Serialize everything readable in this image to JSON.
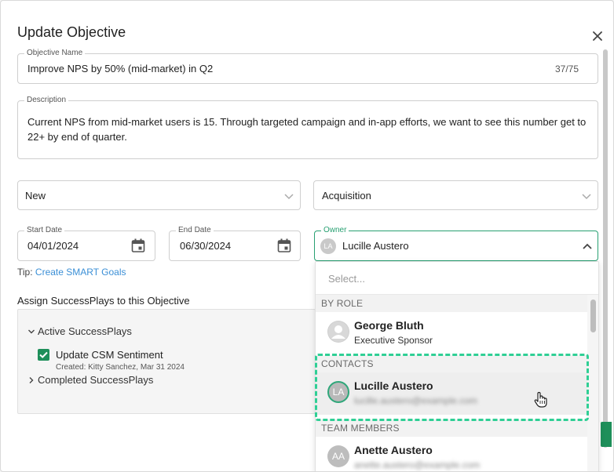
{
  "dialog": {
    "title": "Update Objective"
  },
  "objective_name": {
    "label": "Objective Name",
    "value": "Improve NPS by 50% (mid-market) in Q2",
    "counter": "37/75"
  },
  "description": {
    "label": "Description",
    "value": "Current NPS from mid-market users is 15. Through targeted campaign and in-app efforts, we want to see this number get to 22+ by end of quarter."
  },
  "status_select": {
    "value": "New"
  },
  "category_select": {
    "value": "Acquisition"
  },
  "start_date": {
    "label": "Start Date",
    "value": "04/01/2024"
  },
  "end_date": {
    "label": "End Date",
    "value": "06/30/2024"
  },
  "owner": {
    "label": "Owner",
    "value": "Lucille Austero",
    "initials": "LA"
  },
  "tip": {
    "prefix": "Tip:",
    "link": "Create SMART Goals"
  },
  "successplays": {
    "section_title": "Assign SuccessPlays to this Objective",
    "active_label": "Active SuccessPlays",
    "completed_label": "Completed SuccessPlays",
    "items": [
      {
        "name": "Update CSM Sentiment",
        "meta": "Created: Kitty Sanchez, Mar 31 2024",
        "checked": true
      }
    ]
  },
  "owner_dropdown": {
    "search_placeholder": "Select...",
    "groups": [
      {
        "header": "BY ROLE",
        "items": [
          {
            "name": "George Bluth",
            "subtitle": "Executive Sponsor"
          }
        ]
      },
      {
        "header": "CONTACTS",
        "items": [
          {
            "name": "Lucille Austero",
            "initials": "LA",
            "subtitle": "lucille.austero@example.com",
            "selected": true
          }
        ]
      },
      {
        "header": "TEAM MEMBERS",
        "items": [
          {
            "name": "Anette Austero",
            "initials": "AA",
            "subtitle": "anette.austero@example.com"
          }
        ]
      }
    ]
  },
  "colors": {
    "accent_green": "#1e8f5a",
    "highlight_dash": "#2fcf95",
    "link_blue": "#3b8fd6"
  }
}
